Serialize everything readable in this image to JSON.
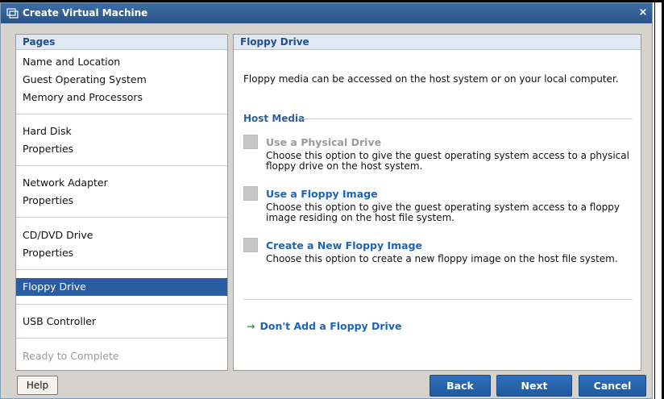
{
  "window": {
    "title": "Create Virtual Machine",
    "close_label": "×",
    "icon": "vm-window-icon"
  },
  "pages": {
    "header": "Pages",
    "items": [
      {
        "label": "Name and Location",
        "state": "normal"
      },
      {
        "label": "Guest Operating System",
        "state": "normal"
      },
      {
        "label": "Memory and Processors",
        "state": "normal"
      },
      {
        "label": "Hard Disk",
        "state": "normal"
      },
      {
        "label": "Properties",
        "state": "normal"
      },
      {
        "label": "Network Adapter",
        "state": "normal"
      },
      {
        "label": "Properties",
        "state": "normal"
      },
      {
        "label": "CD/DVD Drive",
        "state": "normal"
      },
      {
        "label": "Properties",
        "state": "normal"
      },
      {
        "label": "Floppy Drive",
        "state": "selected"
      },
      {
        "label": "USB Controller",
        "state": "normal"
      },
      {
        "label": "Ready to Complete",
        "state": "disabled"
      }
    ]
  },
  "content": {
    "header": "Floppy Drive",
    "description": "Floppy media can be accessed on the host system or on your local computer.",
    "host_media_label": "Host Media",
    "options": [
      {
        "title": "Use a Physical Drive",
        "desc": "Choose this option to give the guest operating system access to a physical floppy drive on the host system.",
        "enabled": false
      },
      {
        "title": "Use a Floppy Image",
        "desc": "Choose this option to give the guest operating system access to a floppy image residing on the host file system.",
        "enabled": true
      },
      {
        "title": "Create a New Floppy Image",
        "desc": "Choose this option to create a new floppy image on the host file system.",
        "enabled": true
      }
    ],
    "dont_add_label": "Don't Add a Floppy Drive",
    "arrow": "→"
  },
  "buttons": {
    "help": "Help",
    "back": "Back",
    "next": "Next",
    "cancel": "Cancel"
  },
  "colors": {
    "title_bar": "#2f5f96",
    "link_blue": "#1e64b4",
    "selected_bg": "#2a5da0",
    "header_text": "#1f4f8c",
    "arrow_green": "#2aa52a"
  }
}
